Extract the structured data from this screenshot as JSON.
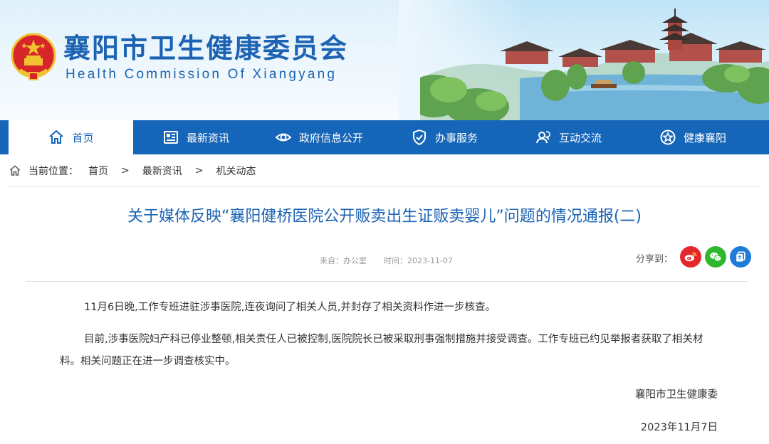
{
  "header": {
    "title": "襄阳市卫生健康委员会",
    "subtitle": "Health Commission Of Xiangyang"
  },
  "nav": {
    "items": [
      {
        "label": "首页",
        "icon": "home-icon",
        "active": true
      },
      {
        "label": "最新资讯",
        "icon": "news-icon",
        "active": false
      },
      {
        "label": "政府信息公开",
        "icon": "eye-icon",
        "active": false
      },
      {
        "label": "办事服务",
        "icon": "shield-icon",
        "active": false
      },
      {
        "label": "互动交流",
        "icon": "chat-icon",
        "active": false
      },
      {
        "label": "健康襄阳",
        "icon": "star-badge-icon",
        "active": false
      }
    ]
  },
  "breadcrumb": {
    "prefix": "当前位置：",
    "items": [
      "首页",
      "最新资讯",
      "机关动态"
    ],
    "separator": ">"
  },
  "article": {
    "title": "关于媒体反映“襄阳健桥医院公开贩卖出生证贩卖婴儿”问题的情况通报(二)",
    "source": "来自：办公室",
    "time": "时间：2023-11-07",
    "share_label": "分享到：",
    "paragraphs": [
      "11月6日晚,工作专班进驻涉事医院,连夜询问了相关人员,并封存了相关资料作进一步核查。",
      "目前,涉事医院妇产科已停业整顿,相关责任人已被控制,医院院长已被采取刑事强制措施并接受调查。工作专班已约见举报者获取了相关材料。相关问题正在进一步调查核实中。"
    ],
    "signature": "襄阳市卫生健康委",
    "date": "2023年11月7日"
  },
  "colors": {
    "brand_blue": "#1565b8",
    "title_blue": "#1c63b3",
    "weibo_red": "#e5262b",
    "wechat_green": "#2eb82e",
    "qzone_blue": "#1f7bd8"
  }
}
